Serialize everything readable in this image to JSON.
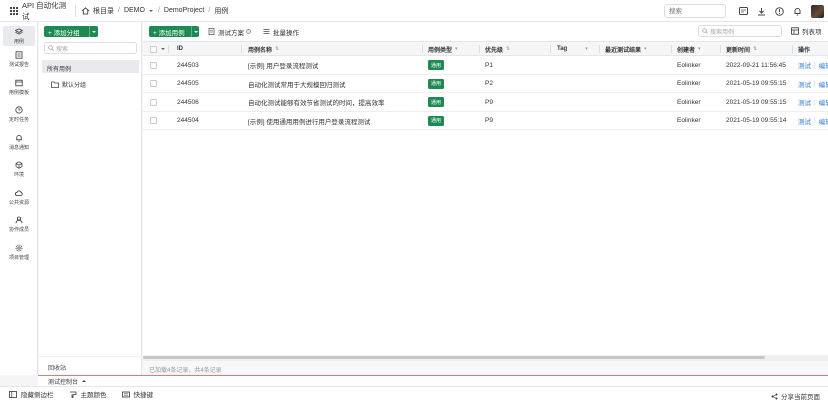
{
  "topbar": {
    "app_title": "API 自动化测试",
    "breadcrumbs": [
      "根目录",
      "DEMO",
      "DemoProject",
      "用例"
    ],
    "search_placeholder": "搜索"
  },
  "leftnav": {
    "items": [
      {
        "label": "用例",
        "icon": "layers-icon",
        "active": true
      },
      {
        "label": "测试报告",
        "icon": "report-icon"
      },
      {
        "label": "用例模板",
        "icon": "template-icon"
      },
      {
        "label": "定时任务",
        "icon": "clock-icon"
      },
      {
        "label": "消息通知",
        "icon": "bell-icon"
      },
      {
        "label": "环境",
        "icon": "cube-icon"
      },
      {
        "label": "公共资源",
        "icon": "cloud-icon"
      },
      {
        "label": "协作成员",
        "icon": "member-icon"
      },
      {
        "label": "项目管理",
        "icon": "gear-icon"
      }
    ]
  },
  "groups": {
    "add_label": "+ 添加分组",
    "search_placeholder": "搜索",
    "all_label": "所有用例",
    "default_label": "默认分组",
    "recycle_label": "回收站"
  },
  "toolbar": {
    "add_case_label": "+ 添加用例",
    "plan_label": "测试方案",
    "batch_label": "批量操作",
    "search_placeholder": "搜索用例",
    "columns_label": "列表项"
  },
  "table": {
    "headers": {
      "id": "ID",
      "name": "用例名称",
      "type": "用例类型",
      "priority": "优先级",
      "tag": "Tag",
      "last_result": "最近测试结果",
      "creator": "创建者",
      "updated": "更新时间",
      "ops": "操作"
    },
    "rows": [
      {
        "id": "244503",
        "name": "[示例] 用户登录流程测试",
        "type": "通用",
        "priority": "P1",
        "creator": "Eolinker",
        "updated": "2022-09-21 11:56:45",
        "op_test": "测试",
        "op_edit": "编辑"
      },
      {
        "id": "244505",
        "name": "自动化测试常用于大规模回归测试",
        "type": "通用",
        "priority": "P2",
        "creator": "Eolinker",
        "updated": "2021-05-19 09:55:15",
        "op_test": "测试",
        "op_edit": "编辑"
      },
      {
        "id": "244506",
        "name": "自动化测试能够有效节省测试的时间，提高效率",
        "type": "通用",
        "priority": "P9",
        "creator": "Eolinker",
        "updated": "2021-05-19 09:55:15",
        "op_test": "测试",
        "op_edit": "编辑"
      },
      {
        "id": "244504",
        "name": "[示例] 使用通用用例进行用户登录流程测试",
        "type": "通用",
        "priority": "P9",
        "creator": "Eolinker",
        "updated": "2021-05-19 09:55:14",
        "op_test": "测试",
        "op_edit": "编辑"
      }
    ],
    "footer_info": "已加载4条记录，共4条记录"
  },
  "console": {
    "label": "测试控制台"
  },
  "bottombar": {
    "hide_sidebar": "隐藏侧边栏",
    "theme": "主题颜色",
    "shortcuts": "快捷键",
    "share": "分享当前页面"
  },
  "colors": {
    "accent": "#1e8a53",
    "link": "#2f7bd9"
  }
}
